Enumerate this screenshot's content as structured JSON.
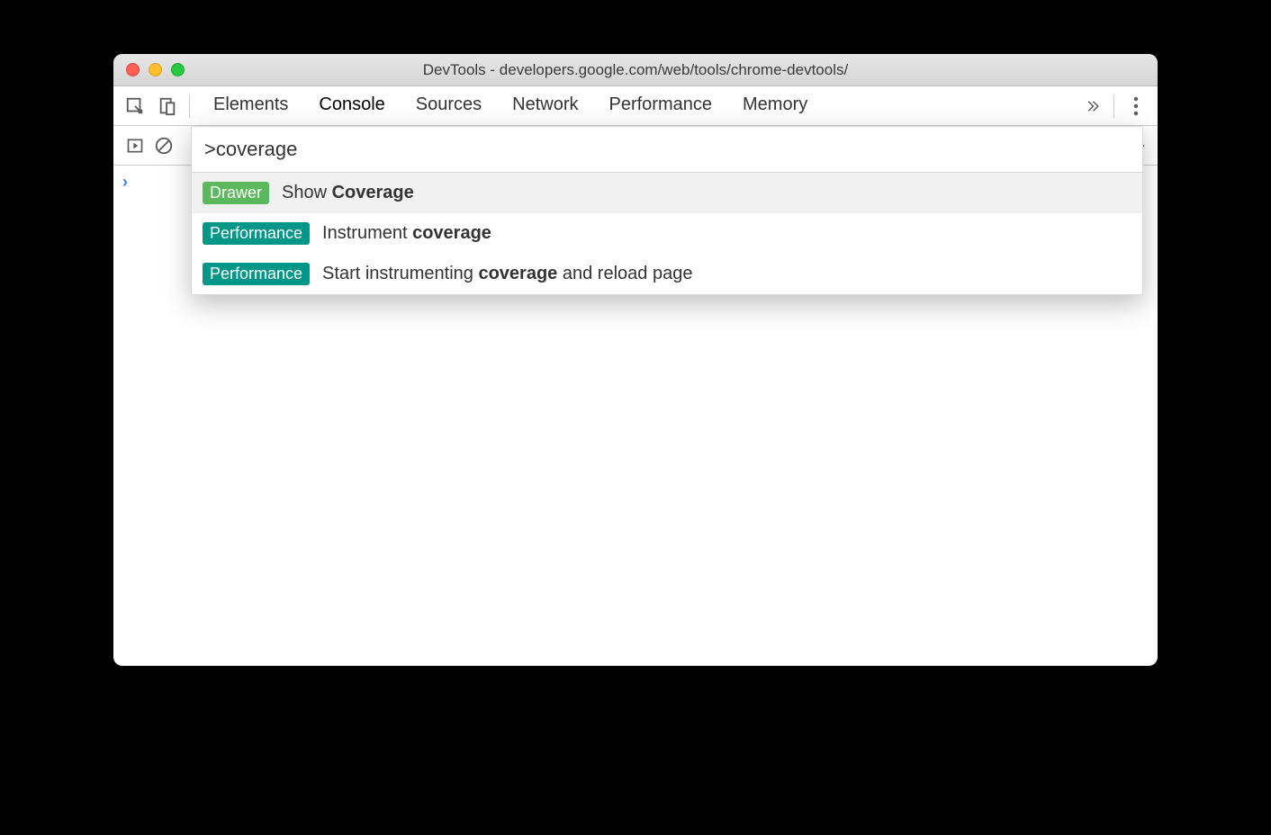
{
  "window": {
    "title": "DevTools - developers.google.com/web/tools/chrome-devtools/"
  },
  "tabs": {
    "items": [
      "Elements",
      "Console",
      "Sources",
      "Network",
      "Performance",
      "Memory"
    ],
    "active": "Console"
  },
  "command_menu": {
    "input_value": ">coverage",
    "results": [
      {
        "badge": "Drawer",
        "badge_kind": "drawer",
        "prefix": "Show ",
        "match": "Coverage",
        "suffix": ""
      },
      {
        "badge": "Performance",
        "badge_kind": "perf",
        "prefix": "Instrument ",
        "match": "coverage",
        "suffix": ""
      },
      {
        "badge": "Performance",
        "badge_kind": "perf",
        "prefix": "Start instrumenting ",
        "match": "coverage",
        "suffix": " and reload page"
      }
    ],
    "selected_index": 0
  },
  "console": {
    "prompt": "›"
  }
}
